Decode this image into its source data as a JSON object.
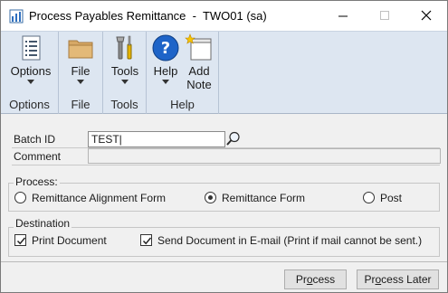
{
  "window": {
    "title": "Process Payables Remittance  -  TWO01 (sa)"
  },
  "ribbon": {
    "groups": [
      {
        "label": "Options",
        "button": "Options"
      },
      {
        "label": "File",
        "button": "File"
      },
      {
        "label": "Tools",
        "button": "Tools"
      },
      {
        "label": "Help",
        "buttons": [
          "Help",
          "Add",
          "Note"
        ]
      }
    ]
  },
  "form": {
    "batch_id_label": "Batch ID",
    "batch_id_value": "TEST|",
    "comment_label": "Comment",
    "comment_value": "",
    "process_group": {
      "title": "Process:",
      "options": [
        {
          "label": "Remittance Alignment Form",
          "selected": false
        },
        {
          "label": "Remittance Form",
          "selected": true
        },
        {
          "label": "Post",
          "selected": false
        }
      ]
    },
    "destination_group": {
      "title": "Destination",
      "options": [
        {
          "label": "Print Document",
          "checked": true
        },
        {
          "label": "Send Document in E-mail (Print if mail cannot be sent.)",
          "checked": true
        }
      ]
    }
  },
  "footer": {
    "process_pre": "Pr",
    "process_u": "o",
    "process_post": "cess",
    "later_pre": "Pr",
    "later_u": "o",
    "later_post": "cess Later"
  },
  "colors": {
    "ribbon_bg": "#dde6f1",
    "window_bg": "#f0f0f0",
    "help_blue": "#1e64c8"
  }
}
